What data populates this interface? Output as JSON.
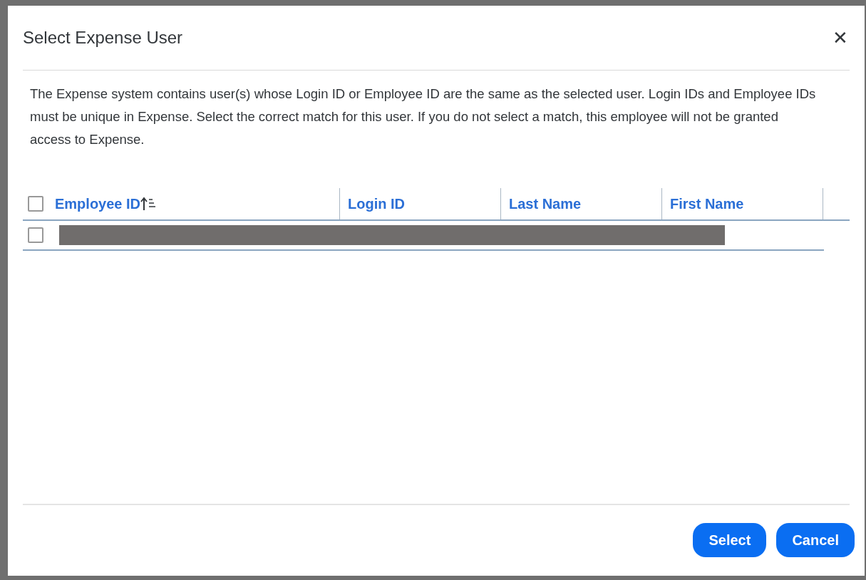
{
  "dialog": {
    "title": "Select Expense User",
    "close": "✕",
    "message": "The Expense system contains user(s) whose Login ID or Employee ID are the same as the selected user. Login IDs and Employee IDs must be unique in Expense. Select the correct match for this user. If you do not select a match, this employee will not be granted access to Expense.",
    "table": {
      "select_all": {
        "checked": false
      },
      "columns": [
        {
          "label": "Employee ID",
          "sorted": true
        },
        {
          "label": "Login ID",
          "sorted": false
        },
        {
          "label": "Last Name",
          "sorted": false
        },
        {
          "label": "First Name",
          "sorted": false
        }
      ],
      "rows": [
        {
          "checked": false,
          "redacted": true
        }
      ]
    },
    "buttons": [
      {
        "label": "Select"
      },
      {
        "label": "Cancel"
      }
    ]
  }
}
